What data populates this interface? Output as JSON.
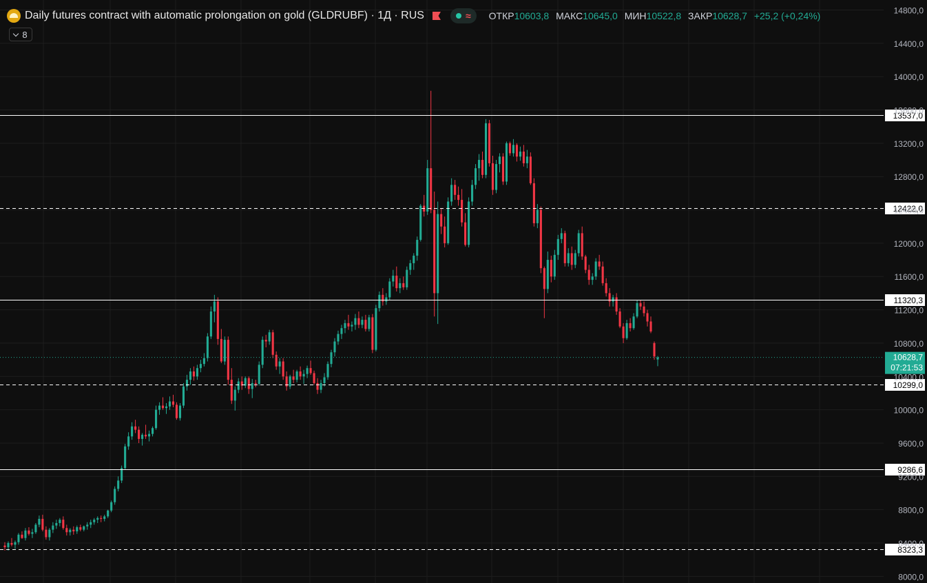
{
  "header": {
    "title": "Daily futures contract with automatic prolongation on gold (GLDRUBF) · 1Д · RUS",
    "open_label": "ОТКР",
    "open_value": "10603,8",
    "high_label": "МАКС",
    "high_value": "10645,0",
    "low_label": "МИН",
    "low_value": "10522,8",
    "close_label": "ЗАКР",
    "close_value": "10628,7",
    "change": "+25,2 (+0,24%)",
    "approx_symbol": "≈"
  },
  "toggle": {
    "count": "8"
  },
  "colors": {
    "up": "#22ab94",
    "down": "#f23645",
    "background": "#0f0f0f",
    "grid": "#1e1e1e",
    "text": "#d1d4dc"
  },
  "chart_data": {
    "type": "candlestick",
    "ylim": [
      7920,
      14920
    ],
    "yticks": [
      {
        "value": 8000,
        "label": "8000,0"
      },
      {
        "value": 8400,
        "label": "8400,0"
      },
      {
        "value": 8800,
        "label": "8800,0"
      },
      {
        "value": 9200,
        "label": "9200,0"
      },
      {
        "value": 9600,
        "label": "9600,0"
      },
      {
        "value": 10000,
        "label": "10000,0"
      },
      {
        "value": 10400,
        "label": "10400,0"
      },
      {
        "value": 10800,
        "label": "10800,0"
      },
      {
        "value": 11200,
        "label": "11200,0"
      },
      {
        "value": 11600,
        "label": "11600,0"
      },
      {
        "value": 12000,
        "label": "12000,0"
      },
      {
        "value": 12400,
        "label": "12400,0"
      },
      {
        "value": 12800,
        "label": "12800,0"
      },
      {
        "value": 13200,
        "label": "13200,0"
      },
      {
        "value": 13600,
        "label": "13600,0"
      },
      {
        "value": 14000,
        "label": "14000,0"
      },
      {
        "value": 14400,
        "label": "14400,0"
      },
      {
        "value": 14800,
        "label": "14800,0"
      }
    ],
    "levels": [
      {
        "value": 13537.0,
        "label": "13537,0",
        "style": "solid"
      },
      {
        "value": 12422.0,
        "label": "12422,0",
        "style": "dashed"
      },
      {
        "value": 11320.3,
        "label": "11320,3",
        "style": "solid"
      },
      {
        "value": 10299.0,
        "label": "10299,0",
        "style": "dashed"
      },
      {
        "value": 9286.6,
        "label": "9286,6",
        "style": "solid"
      },
      {
        "value": 8323.3,
        "label": "8323,3",
        "style": "dashed"
      }
    ],
    "last_price": {
      "value": 10628.7,
      "label": "10628,7",
      "timer": "07:21:53"
    },
    "candles": [
      [
        8370,
        8410,
        8310,
        8350
      ],
      [
        8350,
        8420,
        8310,
        8400
      ],
      [
        8400,
        8460,
        8360,
        8380
      ],
      [
        8380,
        8430,
        8330,
        8410
      ],
      [
        8410,
        8520,
        8380,
        8500
      ],
      [
        8500,
        8540,
        8450,
        8460
      ],
      [
        8460,
        8580,
        8430,
        8550
      ],
      [
        8550,
        8590,
        8490,
        8510
      ],
      [
        8510,
        8570,
        8460,
        8530
      ],
      [
        8530,
        8640,
        8510,
        8620
      ],
      [
        8620,
        8730,
        8590,
        8690
      ],
      [
        8690,
        8740,
        8540,
        8560
      ],
      [
        8560,
        8600,
        8440,
        8470
      ],
      [
        8470,
        8580,
        8430,
        8560
      ],
      [
        8560,
        8650,
        8520,
        8610
      ],
      [
        8610,
        8680,
        8570,
        8640
      ],
      [
        8640,
        8700,
        8600,
        8680
      ],
      [
        8680,
        8720,
        8560,
        8580
      ],
      [
        8580,
        8620,
        8490,
        8530
      ],
      [
        8530,
        8580,
        8490,
        8560
      ],
      [
        8560,
        8600,
        8500,
        8540
      ],
      [
        8540,
        8610,
        8510,
        8590
      ],
      [
        8590,
        8620,
        8540,
        8560
      ],
      [
        8560,
        8610,
        8540,
        8600
      ],
      [
        8600,
        8650,
        8560,
        8620
      ],
      [
        8620,
        8680,
        8580,
        8650
      ],
      [
        8650,
        8700,
        8620,
        8680
      ],
      [
        8680,
        8720,
        8640,
        8700
      ],
      [
        8700,
        8730,
        8650,
        8690
      ],
      [
        8690,
        8740,
        8660,
        8720
      ],
      [
        8720,
        8800,
        8700,
        8790
      ],
      [
        8790,
        8910,
        8770,
        8890
      ],
      [
        8890,
        9080,
        8860,
        9050
      ],
      [
        9050,
        9200,
        9020,
        9150
      ],
      [
        9150,
        9330,
        9120,
        9300
      ],
      [
        9300,
        9590,
        9280,
        9560
      ],
      [
        9560,
        9730,
        9520,
        9680
      ],
      [
        9680,
        9850,
        9640,
        9800
      ],
      [
        9800,
        9880,
        9720,
        9760
      ],
      [
        9760,
        9800,
        9600,
        9650
      ],
      [
        9650,
        9720,
        9570,
        9700
      ],
      [
        9700,
        9820,
        9650,
        9680
      ],
      [
        9680,
        9750,
        9620,
        9710
      ],
      [
        9710,
        9800,
        9680,
        9780
      ],
      [
        9780,
        10050,
        9760,
        10000
      ],
      [
        10000,
        10090,
        9940,
        10050
      ],
      [
        10050,
        10150,
        10000,
        10020
      ],
      [
        10020,
        10080,
        9950,
        10040
      ],
      [
        10040,
        10160,
        10000,
        10100
      ],
      [
        10100,
        10180,
        10030,
        10060
      ],
      [
        10060,
        10090,
        9880,
        9900
      ],
      [
        9900,
        10080,
        9870,
        10050
      ],
      [
        10050,
        10320,
        10020,
        10280
      ],
      [
        10280,
        10420,
        10230,
        10360
      ],
      [
        10360,
        10500,
        10300,
        10460
      ],
      [
        10460,
        10520,
        10350,
        10400
      ],
      [
        10400,
        10540,
        10360,
        10500
      ],
      [
        10500,
        10600,
        10450,
        10550
      ],
      [
        10550,
        10680,
        10520,
        10620
      ],
      [
        10620,
        10920,
        10580,
        10880
      ],
      [
        10880,
        11240,
        10850,
        11180
      ],
      [
        11180,
        11380,
        11050,
        11300
      ],
      [
        11300,
        11350,
        10780,
        10850
      ],
      [
        10850,
        10970,
        10560,
        10580
      ],
      [
        10580,
        10880,
        10540,
        10840
      ],
      [
        10840,
        10880,
        10300,
        10360
      ],
      [
        10360,
        10500,
        10070,
        10110
      ],
      [
        10110,
        10280,
        9990,
        10240
      ],
      [
        10240,
        10380,
        10200,
        10340
      ],
      [
        10340,
        10400,
        10240,
        10290
      ],
      [
        10290,
        10400,
        10260,
        10380
      ],
      [
        10380,
        10400,
        10190,
        10250
      ],
      [
        10250,
        10370,
        10140,
        10320
      ],
      [
        10320,
        10360,
        10270,
        10310
      ],
      [
        10310,
        10580,
        10290,
        10540
      ],
      [
        10540,
        10880,
        10500,
        10840
      ],
      [
        10840,
        10900,
        10750,
        10820
      ],
      [
        10820,
        10960,
        10780,
        10930
      ],
      [
        10930,
        10960,
        10620,
        10660
      ],
      [
        10660,
        10700,
        10480,
        10520
      ],
      [
        10520,
        10620,
        10430,
        10580
      ],
      [
        10580,
        10620,
        10360,
        10400
      ],
      [
        10400,
        10460,
        10230,
        10280
      ],
      [
        10280,
        10420,
        10250,
        10400
      ],
      [
        10400,
        10480,
        10320,
        10360
      ],
      [
        10360,
        10480,
        10330,
        10460
      ],
      [
        10460,
        10520,
        10360,
        10400
      ],
      [
        10400,
        10480,
        10310,
        10430
      ],
      [
        10430,
        10530,
        10380,
        10500
      ],
      [
        10500,
        10590,
        10420,
        10440
      ],
      [
        10440,
        10470,
        10300,
        10320
      ],
      [
        10320,
        10380,
        10190,
        10240
      ],
      [
        10240,
        10360,
        10200,
        10320
      ],
      [
        10320,
        10440,
        10280,
        10390
      ],
      [
        10390,
        10580,
        10360,
        10550
      ],
      [
        10550,
        10720,
        10510,
        10690
      ],
      [
        10690,
        10860,
        10640,
        10820
      ],
      [
        10820,
        10950,
        10780,
        10910
      ],
      [
        10910,
        11020,
        10850,
        10980
      ],
      [
        10980,
        11080,
        10920,
        11040
      ],
      [
        11040,
        11140,
        10960,
        11000
      ],
      [
        11000,
        11060,
        10940,
        11020
      ],
      [
        11020,
        11150,
        10960,
        11100
      ],
      [
        11100,
        11180,
        10980,
        11020
      ],
      [
        11020,
        11120,
        10980,
        11080
      ],
      [
        11080,
        11140,
        10940,
        10970
      ],
      [
        10970,
        11140,
        10940,
        11110
      ],
      [
        11110,
        11150,
        10680,
        10720
      ],
      [
        10720,
        11260,
        10700,
        11220
      ],
      [
        11220,
        11420,
        11180,
        11380
      ],
      [
        11380,
        11460,
        11250,
        11300
      ],
      [
        11300,
        11400,
        11260,
        11350
      ],
      [
        11350,
        11580,
        11320,
        11540
      ],
      [
        11540,
        11680,
        11480,
        11610
      ],
      [
        11610,
        11720,
        11420,
        11460
      ],
      [
        11460,
        11580,
        11400,
        11520
      ],
      [
        11520,
        11600,
        11440,
        11470
      ],
      [
        11470,
        11720,
        11440,
        11680
      ],
      [
        11680,
        11800,
        11620,
        11760
      ],
      [
        11760,
        11880,
        11680,
        11850
      ],
      [
        11850,
        12080,
        11790,
        12040
      ],
      [
        12040,
        12470,
        12020,
        12450
      ],
      [
        12450,
        12580,
        12320,
        12380
      ],
      [
        12380,
        13000,
        12340,
        12900
      ],
      [
        12900,
        13830,
        12360,
        12400
      ],
      [
        12400,
        12620,
        11120,
        11400
      ],
      [
        11400,
        12500,
        11030,
        12350
      ],
      [
        12350,
        12420,
        12110,
        12200
      ],
      [
        12200,
        12320,
        11950,
        12000
      ],
      [
        12000,
        12550,
        11980,
        12500
      ],
      [
        12500,
        12780,
        12450,
        12700
      ],
      [
        12700,
        12760,
        12520,
        12580
      ],
      [
        12580,
        12680,
        12450,
        12520
      ],
      [
        12520,
        12650,
        12200,
        12250
      ],
      [
        12250,
        12360,
        11960,
        11980
      ],
      [
        11980,
        12550,
        11950,
        12500
      ],
      [
        12500,
        12760,
        12450,
        12700
      ],
      [
        12700,
        12950,
        12650,
        12900
      ],
      [
        12900,
        13070,
        12750,
        13000
      ],
      [
        13000,
        13100,
        12780,
        12820
      ],
      [
        12820,
        13490,
        12780,
        13440
      ],
      [
        13440,
        13480,
        12920,
        12960
      ],
      [
        12960,
        13050,
        12580,
        12640
      ],
      [
        12640,
        13000,
        12600,
        12950
      ],
      [
        12950,
        13080,
        12850,
        13040
      ],
      [
        13040,
        13080,
        12700,
        12740
      ],
      [
        12740,
        13220,
        12700,
        13200
      ],
      [
        13200,
        13220,
        13050,
        13080
      ],
      [
        13080,
        13250,
        13040,
        13180
      ],
      [
        13180,
        13200,
        12980,
        13040
      ],
      [
        13040,
        13160,
        12990,
        13100
      ],
      [
        13100,
        13180,
        12920,
        12960
      ],
      [
        12960,
        13120,
        12900,
        13040
      ],
      [
        13040,
        13090,
        12700,
        12720
      ],
      [
        12720,
        12780,
        12200,
        12240
      ],
      [
        12240,
        12470,
        12180,
        12400
      ],
      [
        12400,
        12440,
        11640,
        11700
      ],
      [
        11700,
        11720,
        11100,
        11450
      ],
      [
        11450,
        11900,
        11400,
        11800
      ],
      [
        11800,
        11850,
        11530,
        11600
      ],
      [
        11600,
        11920,
        11560,
        11860
      ],
      [
        11860,
        12100,
        11800,
        12050
      ],
      [
        12050,
        12180,
        12000,
        12120
      ],
      [
        12120,
        12150,
        11720,
        11760
      ],
      [
        11760,
        11940,
        11720,
        11880
      ],
      [
        11880,
        11960,
        11680,
        11740
      ],
      [
        11740,
        11920,
        11700,
        11880
      ],
      [
        11880,
        12160,
        11840,
        12120
      ],
      [
        12120,
        12200,
        11800,
        11840
      ],
      [
        11840,
        11860,
        11640,
        11680
      ],
      [
        11680,
        11740,
        11500,
        11560
      ],
      [
        11560,
        11640,
        11500,
        11600
      ],
      [
        11600,
        11820,
        11560,
        11780
      ],
      [
        11780,
        11860,
        11680,
        11720
      ],
      [
        11720,
        11780,
        11490,
        11520
      ],
      [
        11520,
        11580,
        11360,
        11400
      ],
      [
        11400,
        11460,
        11240,
        11300
      ],
      [
        11300,
        11380,
        11240,
        11350
      ],
      [
        11350,
        11400,
        11140,
        11180
      ],
      [
        11180,
        11220,
        10980,
        11000
      ],
      [
        11000,
        11040,
        10800,
        10860
      ],
      [
        10860,
        11080,
        10840,
        11040
      ],
      [
        11040,
        11100,
        10940,
        10980
      ],
      [
        10980,
        11160,
        10960,
        11120
      ],
      [
        11120,
        11320,
        11100,
        11280
      ],
      [
        11280,
        11320,
        11200,
        11240
      ],
      [
        11240,
        11300,
        11120,
        11160
      ],
      [
        11160,
        11200,
        11000,
        11060
      ],
      [
        11060,
        11120,
        10920,
        10940
      ],
      [
        10800,
        10820,
        10600,
        10640
      ],
      [
        10603.8,
        10645,
        10522.8,
        10628.7
      ]
    ]
  }
}
